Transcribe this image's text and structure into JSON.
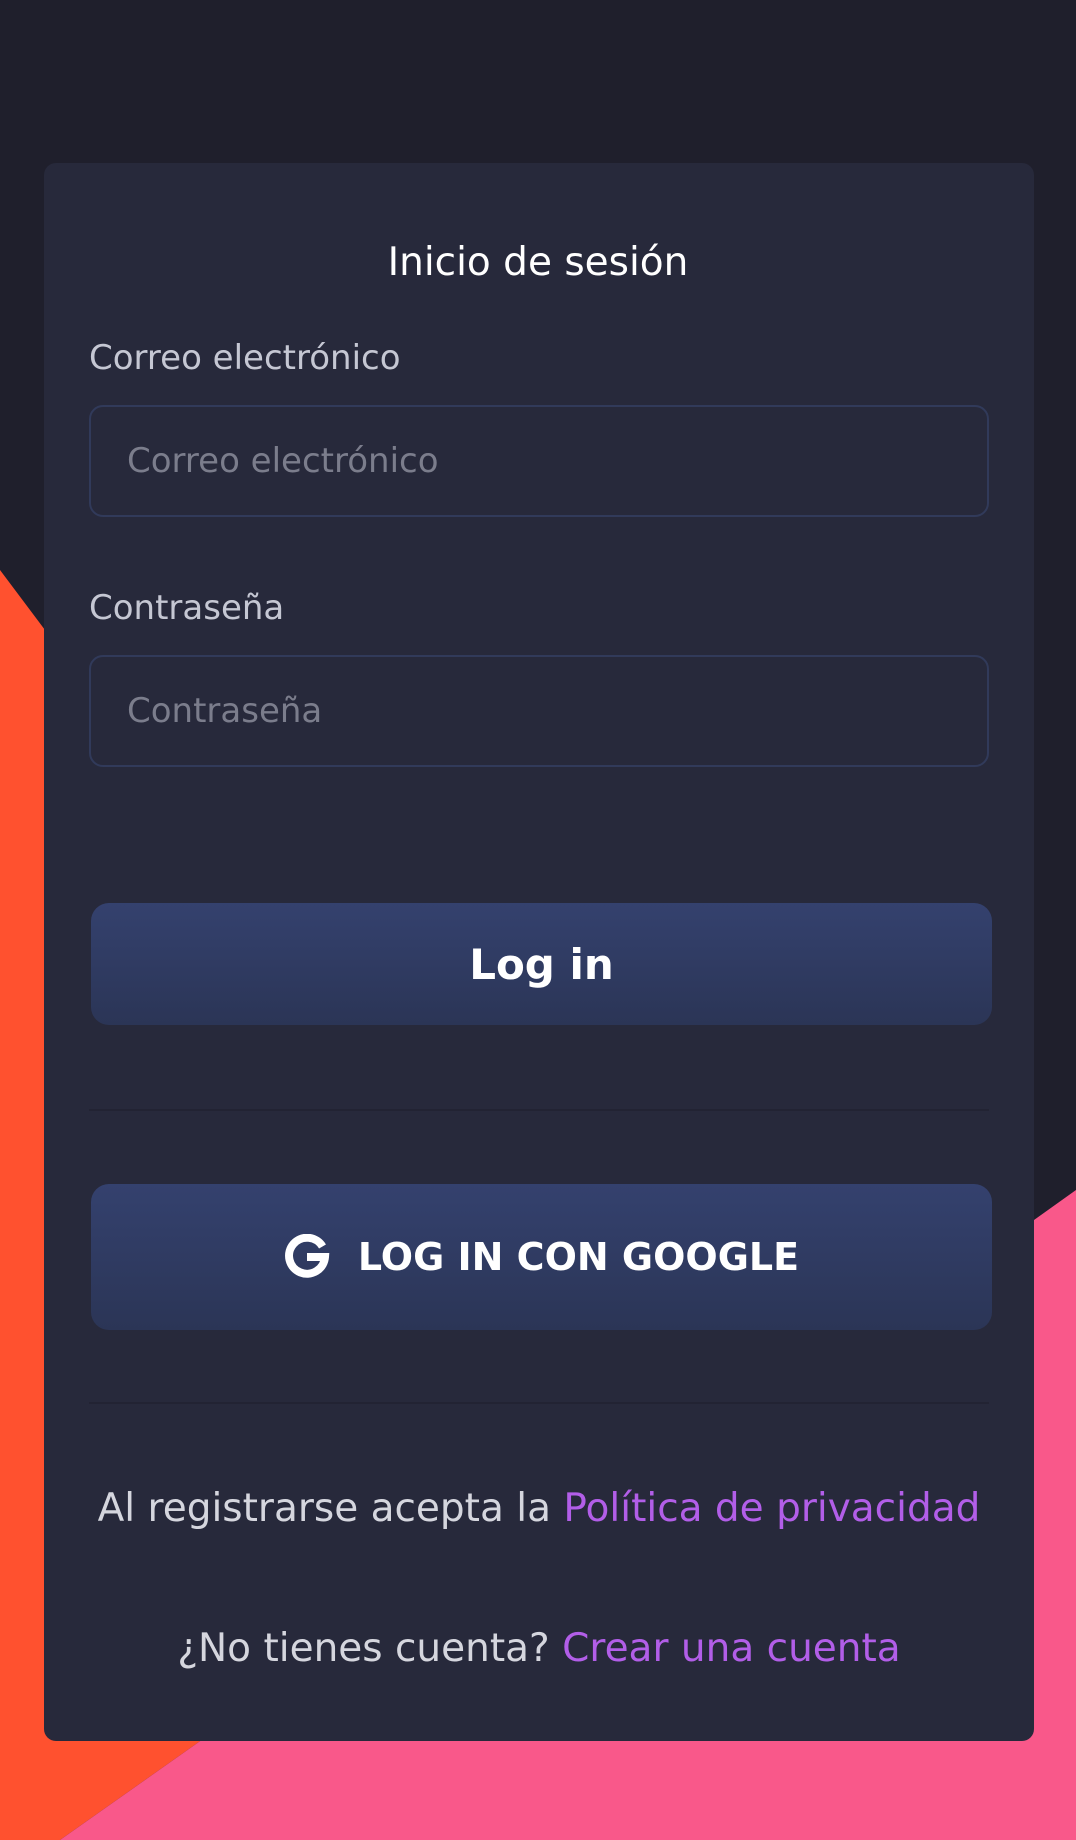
{
  "colors": {
    "background": "#1f1f2c",
    "card": "#27293b",
    "accent_orange": "#ff512f",
    "accent_pink": "#f9588a",
    "link": "#b25ee8",
    "button": "#30395f"
  },
  "login": {
    "title": "Inicio de sesión",
    "email": {
      "label": "Correo electrónico",
      "placeholder": "Correo electrónico",
      "value": ""
    },
    "password": {
      "label": "Contraseña",
      "placeholder": "Contraseña",
      "value": ""
    },
    "login_button": "Log in",
    "google_button": "LOG IN CON GOOGLE",
    "google_icon": "google-icon"
  },
  "footer": {
    "privacy_prefix": "Al registrarse acepta la ",
    "privacy_link": "Política de privacidad",
    "signup_prefix": "¿No tienes cuenta? ",
    "signup_link": "Crear una cuenta"
  }
}
